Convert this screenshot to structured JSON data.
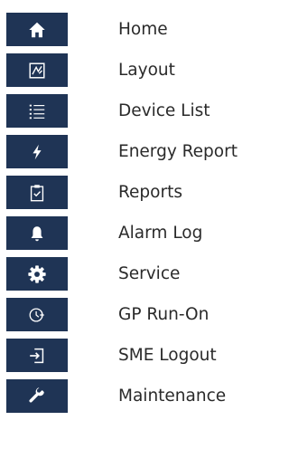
{
  "menu": {
    "items": [
      {
        "label": "Home",
        "icon": "home-icon"
      },
      {
        "label": "Layout",
        "icon": "layout-icon"
      },
      {
        "label": "Device List",
        "icon": "list-icon"
      },
      {
        "label": "Energy Report",
        "icon": "bolt-icon"
      },
      {
        "label": "Reports",
        "icon": "clipboard-check-icon"
      },
      {
        "label": "Alarm Log",
        "icon": "bell-icon"
      },
      {
        "label": "Service",
        "icon": "gear-icon"
      },
      {
        "label": "GP Run-On",
        "icon": "clock-run-icon"
      },
      {
        "label": "SME Logout",
        "icon": "logout-icon"
      },
      {
        "label": "Maintenance",
        "icon": "wrench-icon"
      }
    ]
  },
  "colors": {
    "tile_background": "#1f3455",
    "icon": "#ffffff",
    "label_text": "#2a2a2a"
  }
}
